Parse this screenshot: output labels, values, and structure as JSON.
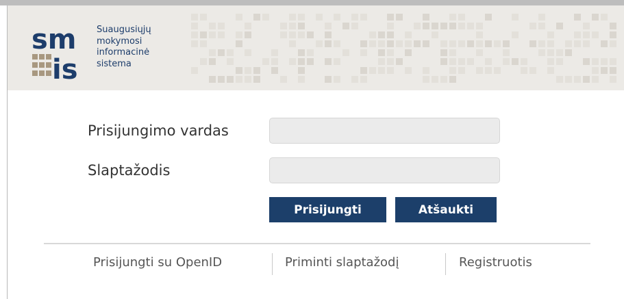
{
  "header": {
    "logo_lines": [
      "Suaugusiųjų",
      "mokymosi",
      "informacinė",
      "sistema"
    ],
    "logo_letters_top": "sm",
    "logo_letters_bottom": "is",
    "logo_color": "#1d3d6b",
    "header_bg": "#eceae6"
  },
  "login_form": {
    "username_label": "Prisijungimo vardas",
    "username_value": "",
    "password_label": "Slaptažodis",
    "password_value": "",
    "login_button": "Prisijungti",
    "cancel_button": "Atšaukti",
    "button_color": "#1c3f6a"
  },
  "footer_links": {
    "openid": "Prisijungti su OpenID",
    "remind_password": "Priminti slaptažodį",
    "register": "Registruotis"
  }
}
